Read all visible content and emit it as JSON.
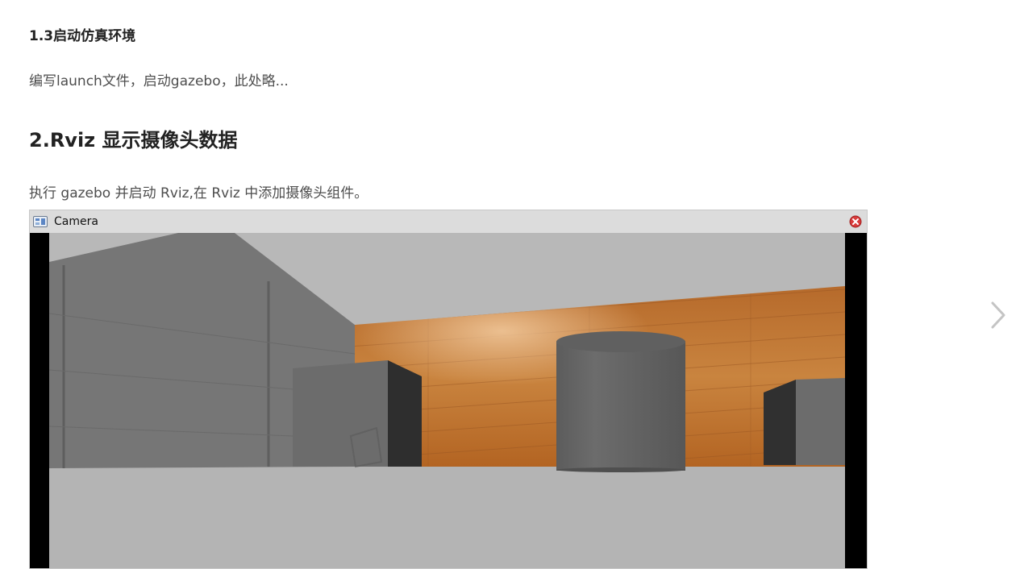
{
  "section": {
    "subheading": "1.3启动仿真环境",
    "paragraph": "编写launch文件，启动gazebo，此处略...",
    "heading": "2.Rviz 显示摄像头数据",
    "paragraph2": "执行 gazebo 并启动 Rviz,在 Rviz 中添加摄像头组件。"
  },
  "camera_window": {
    "title": "Camera",
    "icons": [
      "camera-panel-icon",
      "close-icon"
    ],
    "colors": {
      "titlebar": "#dcdcdc",
      "close": "#d83b3b"
    }
  },
  "navigation": {
    "next_icon": "chevron-right-icon"
  }
}
